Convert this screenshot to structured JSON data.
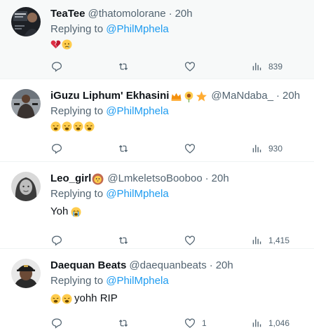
{
  "reply_prefix": "Replying to",
  "tweets": [
    {
      "name": "TeaTee",
      "handle": "@thatomolorane",
      "time": "20h",
      "mention": "@PhilMphela",
      "text": "",
      "emojis": [
        "broken-heart",
        "crying-face"
      ],
      "likes": "",
      "views": "839",
      "avatar": "dark-photo"
    },
    {
      "name": "iGuzu Liphum' Ekhasini",
      "handle": "@MaNdaba_",
      "time": "20h",
      "mention": "@PhilMphela",
      "text": "",
      "emojis": [
        "weary-face",
        "weary-face",
        "weary-face",
        "weary-face"
      ],
      "likes": "",
      "views": "930",
      "avatar": "gym-photo"
    },
    {
      "name": "Leo_girl",
      "handle": "@LmkeletsoBooboo",
      "time": "20h",
      "mention": "@PhilMphela",
      "text": "Yoh",
      "emojis": [
        "loudly-crying-face"
      ],
      "likes": "",
      "views": "1,415",
      "avatar": "grayscale-photo"
    },
    {
      "name": "Daequan Beats",
      "handle": "@daequanbeats",
      "time": "20h",
      "mention": "@PhilMphela",
      "text": "yohh RIP",
      "emojis": [
        "weary-face",
        "weary-face"
      ],
      "likes": "1",
      "views": "1,046",
      "avatar": "man-in-cap-photo"
    }
  ],
  "colors": {
    "link": "#1d9bf0",
    "muted": "#536471",
    "text": "#0f1419",
    "highlight_bg": "#f7f9f9"
  }
}
